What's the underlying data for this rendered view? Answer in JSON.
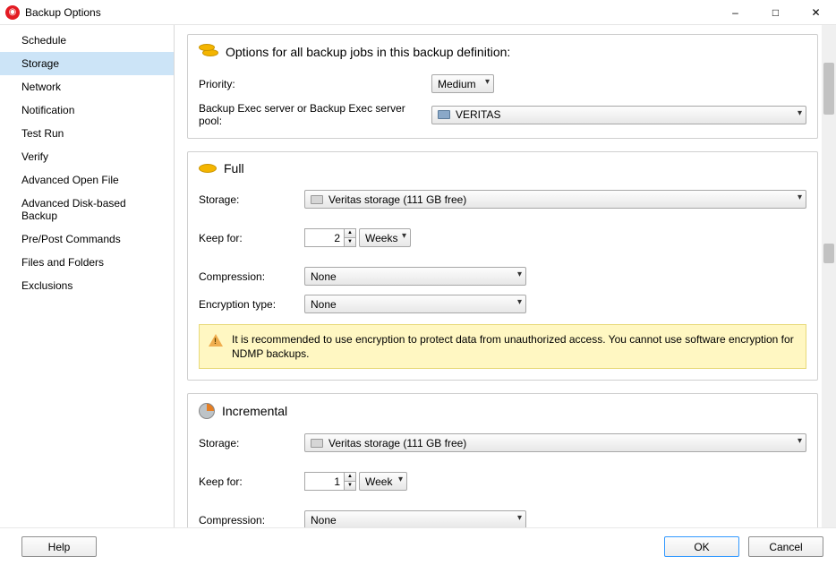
{
  "window": {
    "title": "Backup Options"
  },
  "sidebar": {
    "items": [
      "Schedule",
      "Storage",
      "Network",
      "Notification",
      "Test Run",
      "Verify",
      "Advanced Open File",
      "Advanced Disk-based Backup",
      "Pre/Post Commands",
      "Files and Folders",
      "Exclusions"
    ],
    "active_index": 1
  },
  "global": {
    "heading": "Options for all backup jobs in this backup definition:",
    "priority_label": "Priority:",
    "priority_value": "Medium",
    "server_label": "Backup Exec server or Backup Exec server pool:",
    "server_value": "VERITAS"
  },
  "full": {
    "title": "Full",
    "storage_label": "Storage:",
    "storage_value": "Veritas storage (111 GB free)",
    "keepfor_label": "Keep for:",
    "keepfor_value": "2",
    "keepfor_unit": "Weeks",
    "compression_label": "Compression:",
    "compression_value": "None",
    "encryption_label": "Encryption type:",
    "encryption_value": "None",
    "warning": "It is recommended to use encryption to protect data from unauthorized access. You cannot use software encryption for NDMP backups."
  },
  "incremental": {
    "title": "Incremental",
    "storage_label": "Storage:",
    "storage_value": "Veritas storage (111 GB free)",
    "keepfor_label": "Keep for:",
    "keepfor_value": "1",
    "keepfor_unit": "Week",
    "compression_label": "Compression:",
    "compression_value": "None"
  },
  "buttons": {
    "help": "Help",
    "ok": "OK",
    "cancel": "Cancel"
  }
}
